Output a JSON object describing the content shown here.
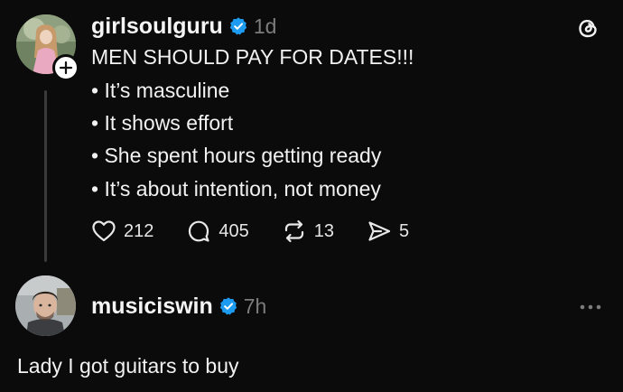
{
  "post": {
    "username": "girlsoulguru",
    "time": "1d",
    "headline": "MEN SHOULD PAY FOR DATES!!!",
    "bullets": [
      "• It’s masculine",
      "• It shows effort",
      "• She spent hours getting ready",
      "• It’s about intention, not money"
    ],
    "likes": "212",
    "comments": "405",
    "reposts": "13",
    "shares": "5"
  },
  "reply": {
    "username": "musiciswin",
    "time": "7h",
    "text": "Lady I got guitars to buy"
  },
  "colors": {
    "background": "#0b0b0b",
    "verified": "#1d9bf0",
    "muted": "#7c7c7c"
  },
  "icons": [
    "threads-logo-icon",
    "plus-icon",
    "verified-badge-icon",
    "heart-icon",
    "comment-icon",
    "repost-icon",
    "share-icon",
    "more-icon"
  ]
}
